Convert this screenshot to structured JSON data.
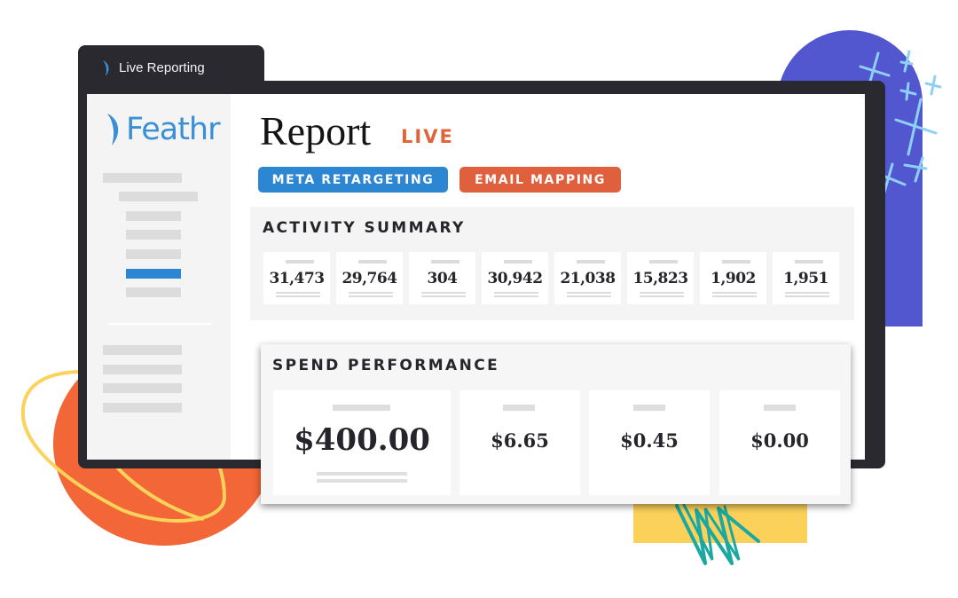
{
  "window": {
    "tab_label": "Live Reporting",
    "brand": "Feathr"
  },
  "report": {
    "title": "Report",
    "badge": "LIVE",
    "tags": [
      {
        "label": "META RETARGETING",
        "color": "#2d86d1"
      },
      {
        "label": "EMAIL MAPPING",
        "color": "#e0603d"
      }
    ]
  },
  "activity_summary": {
    "title": "ACTIVITY SUMMARY",
    "values": [
      "31,473",
      "29,764",
      "304",
      "30,942",
      "21,038",
      "15,823",
      "1,902",
      "1,951"
    ]
  },
  "spend_performance": {
    "title": "SPEND PERFORMANCE",
    "values": [
      "$400.00",
      "$6.65",
      "$0.45",
      "$0.00"
    ]
  },
  "sidebar": {
    "active_item_index": 5,
    "accent": "#2d86d1"
  },
  "colors": {
    "brand_blue": "#3a8fd6",
    "live_orange": "#e0633a",
    "frame_dark": "#2a2930",
    "deco_purple": "#5257cf",
    "deco_orange": "#f26638",
    "deco_yellow": "#fcd15a",
    "deco_teal": "#1aa8a0"
  }
}
